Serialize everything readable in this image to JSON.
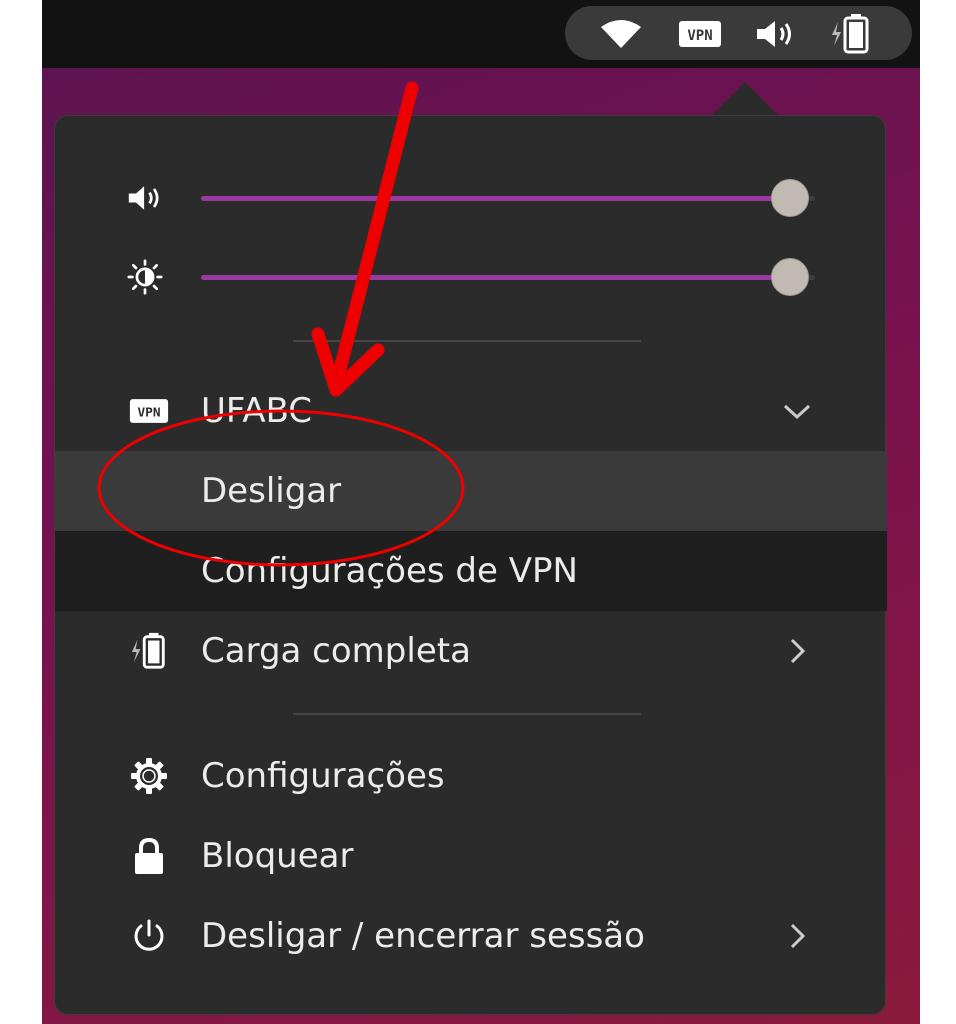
{
  "tray": {
    "icons": [
      "wifi-icon",
      "vpn-icon",
      "volume-icon",
      "battery-charging-icon"
    ],
    "vpn_badge": "VPN"
  },
  "sliders": {
    "volume": {
      "icon": "volume-icon",
      "level": 0.96
    },
    "brightness": {
      "icon": "brightness-icon",
      "level": 0.96
    }
  },
  "vpn": {
    "icon": "vpn-icon",
    "badge": "VPN",
    "name": "UFABC",
    "expanded": true,
    "disconnect_label": "Desligar",
    "settings_label": "Configurações de VPN"
  },
  "battery": {
    "icon": "battery-charging-icon",
    "label": "Carga completa"
  },
  "actions": [
    {
      "icon": "gear-icon",
      "label": "Configurações"
    },
    {
      "icon": "lock-icon",
      "label": "Bloquear"
    },
    {
      "icon": "power-icon",
      "label": "Desligar / encerrar sessão"
    }
  ],
  "colors": {
    "menu_bg": "#2b2b2b",
    "accent": "#9a3aa0",
    "highlight_row": "#3a3a3a",
    "annotation": "#ee0000"
  }
}
